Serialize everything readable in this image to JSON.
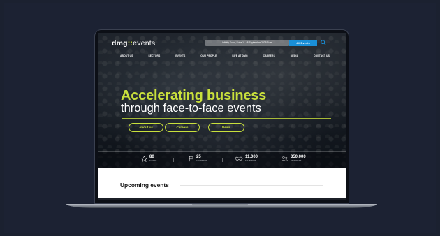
{
  "colors": {
    "accent": "#c9e03c",
    "button_blue": "#1a8fd8",
    "background": "#1b2130"
  },
  "site": {
    "logo_main": "dmg",
    "logo_dots": "::",
    "logo_events": "events",
    "ticker_text": "Infinity Expo, Suite 11 · 8 September 2025 Tues",
    "all_events_label": "All Events"
  },
  "nav": {
    "items": [
      "ABOUT US",
      "SECTORS",
      "EVENTS",
      "OUR PEOPLE",
      "LIFE AT DMG",
      "CAREERS",
      "MEDIA",
      "CONTACT US"
    ]
  },
  "hero": {
    "headline": "Accelerating business",
    "subline": "through face-to-face events",
    "buttons": [
      "About us",
      "Careers",
      "News"
    ]
  },
  "stats": [
    {
      "value": "80",
      "label": "EVENTS",
      "icon": "star-icon"
    },
    {
      "value": "25",
      "label": "COUNTRIES",
      "icon": "flag-icon"
    },
    {
      "value": "11,000",
      "label": "EXHIBITORS",
      "icon": "handshake-icon"
    },
    {
      "value": "350,000",
      "label": "ATTENDEES",
      "icon": "people-icon"
    }
  ],
  "section": {
    "title": "Upcoming events"
  }
}
